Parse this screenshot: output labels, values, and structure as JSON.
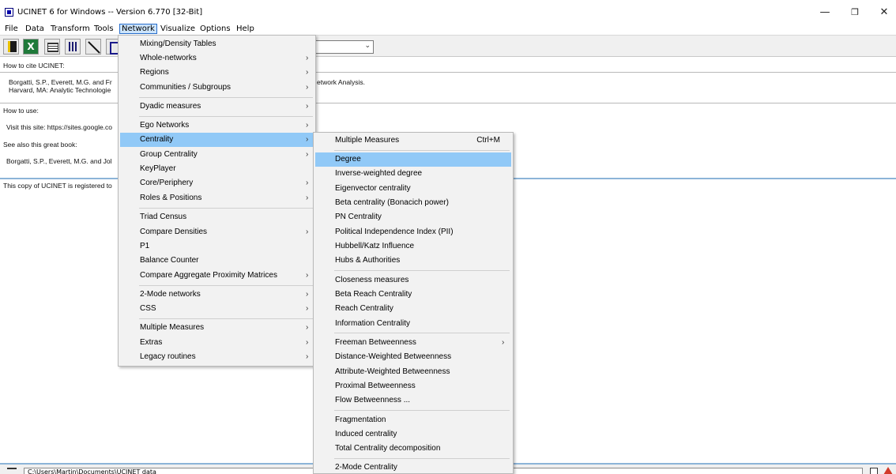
{
  "window": {
    "title": "UCINET 6 for Windows -- Version 6.770 [32-Bit]",
    "minimize_glyph": "—",
    "maximize_glyph": "❐",
    "close_glyph": "✕"
  },
  "menubar": {
    "items": [
      "File",
      "Data",
      "Transform",
      "Tools",
      "Network",
      "Visualize",
      "Options",
      "Help"
    ],
    "active": "Network"
  },
  "toolbar": {
    "icons": [
      "open-icon",
      "excel-icon",
      "matrix-editor-icon",
      "spreadsheet-icon",
      "draw-line-icon",
      "netdraw-icon"
    ]
  },
  "content": {
    "cite_heading": "How to cite UCINET:",
    "cite_line1_left": "Borgatti, S.P., Everett, M.G. and Fr",
    "cite_line1_right": "etwork Analysis.",
    "cite_line2": "Harvard, MA: Analytic Technologie",
    "use_heading": "How to use:",
    "visit_line": "Visit this site: https://sites.google.co",
    "book_heading": "See also this great book:",
    "book_line": "Borgatti, S.P., Everett, M.G. and Jol",
    "registered_line": "This copy of UCINET is registered to"
  },
  "statusbar": {
    "path": "C:\\Users\\Martin\\Documents\\UCINET data"
  },
  "network_menu": {
    "items": [
      {
        "label": "Mixing/Density Tables",
        "submenu": false
      },
      {
        "label": "Whole-networks",
        "submenu": true
      },
      {
        "label": "Regions",
        "submenu": true
      },
      {
        "label": "Communities / Subgroups",
        "submenu": true
      },
      {
        "label": "Dyadic measures",
        "submenu": true
      },
      {
        "label": "Ego Networks",
        "submenu": true
      },
      {
        "label": "Centrality",
        "submenu": true,
        "highlighted": true
      },
      {
        "label": "Group Centrality",
        "submenu": true
      },
      {
        "label": "KeyPlayer",
        "submenu": false
      },
      {
        "label": "Core/Periphery",
        "submenu": true
      },
      {
        "label": "Roles & Positions",
        "submenu": true
      },
      {
        "label": "Triad Census",
        "submenu": false
      },
      {
        "label": "Compare Densities",
        "submenu": true
      },
      {
        "label": "P1",
        "submenu": false
      },
      {
        "label": "Balance Counter",
        "submenu": false
      },
      {
        "label": "Compare Aggregate Proximity Matrices",
        "submenu": true
      },
      {
        "label": "2-Mode networks",
        "submenu": true
      },
      {
        "label": "CSS",
        "submenu": true
      },
      {
        "label": "Multiple Measures",
        "submenu": true
      },
      {
        "label": "Extras",
        "submenu": true
      },
      {
        "label": "Legacy routines",
        "submenu": true
      }
    ]
  },
  "centrality_menu": {
    "items": [
      {
        "label": "Multiple Measures",
        "shortcut": "Ctrl+M",
        "submenu": false
      },
      {
        "label": "Degree",
        "submenu": false,
        "highlighted": true
      },
      {
        "label": "Inverse-weighted degree",
        "submenu": false
      },
      {
        "label": "Eigenvector centrality",
        "submenu": false
      },
      {
        "label": "Beta centrality (Bonacich power)",
        "submenu": false
      },
      {
        "label": "PN Centrality",
        "submenu": false
      },
      {
        "label": "Political Independence Index (PII)",
        "submenu": false
      },
      {
        "label": "Hubbell/Katz Influence",
        "submenu": false
      },
      {
        "label": "Hubs & Authorities",
        "submenu": false
      },
      {
        "label": "Closeness measures",
        "submenu": false
      },
      {
        "label": "Beta Reach Centrality",
        "submenu": false
      },
      {
        "label": "Reach Centrality",
        "submenu": false
      },
      {
        "label": "Information Centrality",
        "submenu": false
      },
      {
        "label": "Freeman Betweenness",
        "submenu": true
      },
      {
        "label": "Distance-Weighted Betweenness",
        "submenu": false
      },
      {
        "label": "Attribute-Weighted Betweenness",
        "submenu": false
      },
      {
        "label": "Proximal Betweenness",
        "submenu": false
      },
      {
        "label": "Flow Betweenness ...",
        "submenu": false
      },
      {
        "label": "Fragmentation",
        "submenu": false
      },
      {
        "label": "Induced centrality",
        "submenu": false
      },
      {
        "label": "Total Centrality decomposition",
        "submenu": false
      },
      {
        "label": "2-Mode Centrality",
        "submenu": false
      }
    ]
  },
  "arrow_glyph": "›",
  "combo_caret": "⌄"
}
